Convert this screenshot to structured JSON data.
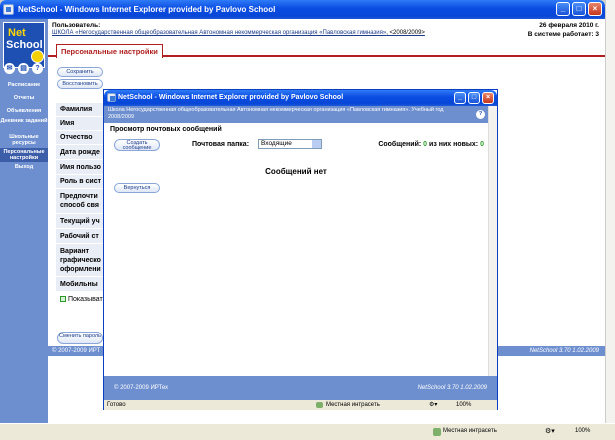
{
  "main_window": {
    "title": "NetSchool - Windows Internet Explorer provided by Pavlovo School"
  },
  "sidebar": {
    "logo_line1": "Net",
    "logo_line2": "School",
    "items": [
      {
        "label": "Расписание"
      },
      {
        "label": "Отчеты"
      },
      {
        "label": "Объявления"
      },
      {
        "label": "Дневник заданий"
      },
      {
        "label": "Школьные ресурсы"
      },
      {
        "label": "Персональные настройки"
      },
      {
        "label": "Выход"
      }
    ]
  },
  "header": {
    "users_label": "Пользователь:",
    "school_link": "ШКОЛА «Негосударственная общеобразовательная Автономная некоммерческая организация «Павловская гимназия»",
    "school_year": ", <2008/2009>",
    "date": "26 февраля 2010 г.",
    "online_label": "В системе работает:",
    "online_count": "3"
  },
  "tab": {
    "label": "Персональные настройки"
  },
  "buttons": {
    "save": "Сохранить",
    "restore": "Восстановить",
    "change_password": "Сменить пароль"
  },
  "settings_rows": [
    "Фамилия",
    "Имя",
    "Отчество",
    "Дата рожде",
    "Имя пользо",
    "Роль в сист",
    "Предпочти способ свя",
    "Текущий уч",
    "Рабочий ст",
    "Вариант графическо оформлени",
    "Мобильны"
  ],
  "show_label": "Показыват",
  "main_footer": {
    "copyright": "© 2007-2009 ИРТ",
    "version": "NetSchool  3.70   1.02.2009"
  },
  "main_status": {
    "zone": "Местная интрасеть",
    "zoom": "100%"
  },
  "popup": {
    "title": "NetSchool - Windows Internet Explorer provided by Pavlovo School",
    "school_info": "Школа Негосударственная общеобразовательная Автономная некоммерческая организация «Павловская гимназия». Учебный год 2008/2009",
    "help": "?",
    "section_title": "Просмотр почтовых сообщений",
    "create_button": "Создать сообщение",
    "folder_label": "Почтовая папка:",
    "folder_value": "Входящие",
    "messages_label": "Сообщений:",
    "messages_count": "0",
    "new_label": "из них новых:",
    "new_count": "0",
    "no_messages": "Сообщений нет",
    "back_button": "Вернуться",
    "footer_copyright": "© 2007-2009 ИРТех",
    "footer_version": "NetSchool  3.70   1.02.2009",
    "status_ready": "Готово",
    "status_zone": "Местная интрасеть",
    "status_zoom": "100%"
  }
}
